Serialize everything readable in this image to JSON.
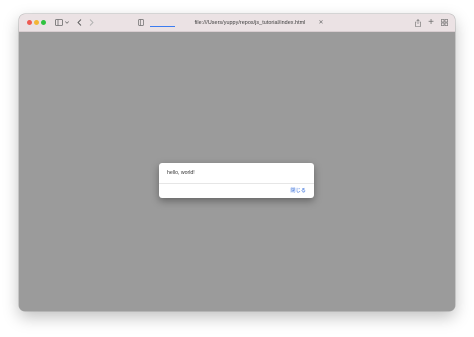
{
  "browser": {
    "url": "file:///Users/yuppy/repos/js_tutorial/index.html",
    "icons": {
      "sidebar": "sidebar-icon",
      "sidebar_chevron": "chevron-down-icon",
      "back": "back-icon",
      "forward": "forward-icon",
      "shield": "privacy-shield-icon",
      "url_close": "close-icon",
      "share": "share-icon",
      "new_tab": "plus-icon",
      "tabs": "tab-overview-icon"
    },
    "colors": {
      "titlebar": "#ebe2e4",
      "tab_indicator": "#3c7cf0",
      "content_dim": "#9b9b9b"
    }
  },
  "dialog": {
    "message": "hello, world!",
    "button_label": "閉じる",
    "button_color": "#2b66d9"
  }
}
